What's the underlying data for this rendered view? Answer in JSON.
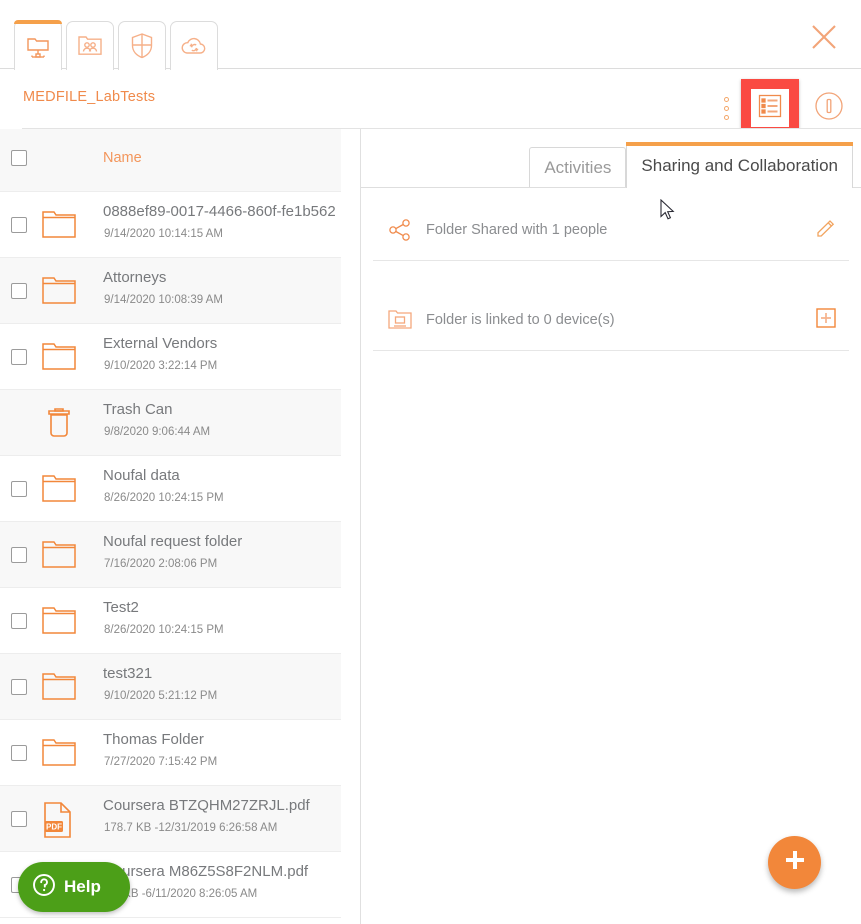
{
  "window": {
    "close_label": "✕",
    "close_icon": "close-icon"
  },
  "tabs": [
    {
      "id": "my-devices",
      "icon": "network-folder-icon",
      "active": true
    },
    {
      "id": "shared-with-me",
      "icon": "shared-folder-people-icon",
      "active": false
    },
    {
      "id": "security",
      "icon": "shield-icon",
      "active": false
    },
    {
      "id": "cloud-sync",
      "icon": "cloud-sync-icon",
      "active": false
    }
  ],
  "breadcrumb": {
    "path": "MEDFILE_LabTests"
  },
  "toolbar": {
    "more_icon": "kebab-menu-icon",
    "details_icon": "details-list-icon",
    "details_highlighted": true,
    "info_icon": "info-circle-icon"
  },
  "file_list": {
    "header": {
      "name_column": "Name"
    },
    "rows": [
      {
        "name": "0888ef89-0017-4466-860f-fe1b562",
        "meta": "9/14/2020 10:14:15 AM",
        "icon": "folder-icon",
        "checkbox": true,
        "selected": false
      },
      {
        "name": "Attorneys",
        "meta": "9/14/2020 10:08:39 AM",
        "icon": "folder-icon",
        "checkbox": true,
        "selected": false
      },
      {
        "name": "External Vendors",
        "meta": "9/10/2020 3:22:14 PM",
        "icon": "folder-icon",
        "checkbox": true,
        "selected": false
      },
      {
        "name": "Trash Can",
        "meta": "9/8/2020 9:06:44 AM",
        "icon": "trash-can-icon",
        "checkbox": false,
        "selected": true
      },
      {
        "name": "Noufal data",
        "meta": "8/26/2020 10:24:15 PM",
        "icon": "folder-icon",
        "checkbox": true,
        "selected": false
      },
      {
        "name": "Noufal request folder",
        "meta": "7/16/2020 2:08:06 PM",
        "icon": "folder-icon",
        "checkbox": true,
        "selected": false
      },
      {
        "name": "Test2",
        "meta": "8/26/2020 10:24:15 PM",
        "icon": "folder-icon",
        "checkbox": true,
        "selected": false
      },
      {
        "name": "test321",
        "meta": "9/10/2020 5:21:12 PM",
        "icon": "folder-icon",
        "checkbox": true,
        "selected": false
      },
      {
        "name": "Thomas Folder",
        "meta": "7/27/2020 7:15:42 PM",
        "icon": "folder-icon",
        "checkbox": true,
        "selected": false
      },
      {
        "name": "Coursera BTZQHM27ZRJL.pdf",
        "meta": "178.7 KB -12/31/2019 6:26:58 AM",
        "icon": "pdf-file-icon",
        "checkbox": true,
        "selected": false
      },
      {
        "name": "Coursera M86Z5S8F2NLM.pdf",
        "meta": "9.1 KB -6/11/2020 8:26:05 AM",
        "icon": "pdf-file-icon",
        "checkbox": true,
        "selected": false
      }
    ]
  },
  "detail_panel": {
    "tabs": [
      {
        "label": "Activities",
        "active": false
      },
      {
        "label": "Sharing and Collaboration",
        "active": true
      }
    ],
    "rows": [
      {
        "text": "Folder Shared with 1 people",
        "icon": "share-nodes-icon",
        "action_icon": "pencil-edit-icon"
      },
      {
        "text": "Folder is linked to 0 device(s)",
        "icon": "linked-folder-device-icon",
        "action_icon": "plus-square-icon"
      }
    ]
  },
  "fab": {
    "label": "+",
    "icon": "plus-icon"
  },
  "help_widget": {
    "label": "Help",
    "icon": "question-circle-icon"
  },
  "colors": {
    "accent_orange": "#f2873a",
    "light_orange": "#f3965c",
    "highlight_red": "#fa4a42",
    "help_green": "#4c9f18",
    "text_gray": "#77797c"
  }
}
